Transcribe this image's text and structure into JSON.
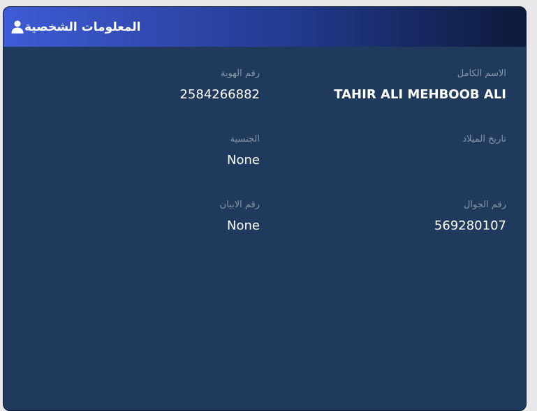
{
  "header": {
    "title": "المعلومات الشخصية",
    "icon": "user-icon"
  },
  "fields": {
    "full_name": {
      "label": "الاسم الكامل",
      "value": "TAHIR ALI MEHBOOB ALI"
    },
    "id_number": {
      "label": "رقم الهوية",
      "value": "2584266882"
    },
    "birth_date": {
      "label": "تاريخ الميلاد",
      "value": ""
    },
    "nationality": {
      "label": "الجنسية",
      "value": "None"
    },
    "mobile": {
      "label": "رقم الجوال",
      "value": "569280107"
    },
    "statement_number": {
      "label": "رقم الابيان",
      "value": "None"
    }
  },
  "colors": {
    "card_bg": "#1f3a5c",
    "header_gradient_start": "#3f5bd6",
    "header_gradient_end": "#0d1a3a",
    "label": "#8a96a6",
    "value": "#ffffff"
  }
}
